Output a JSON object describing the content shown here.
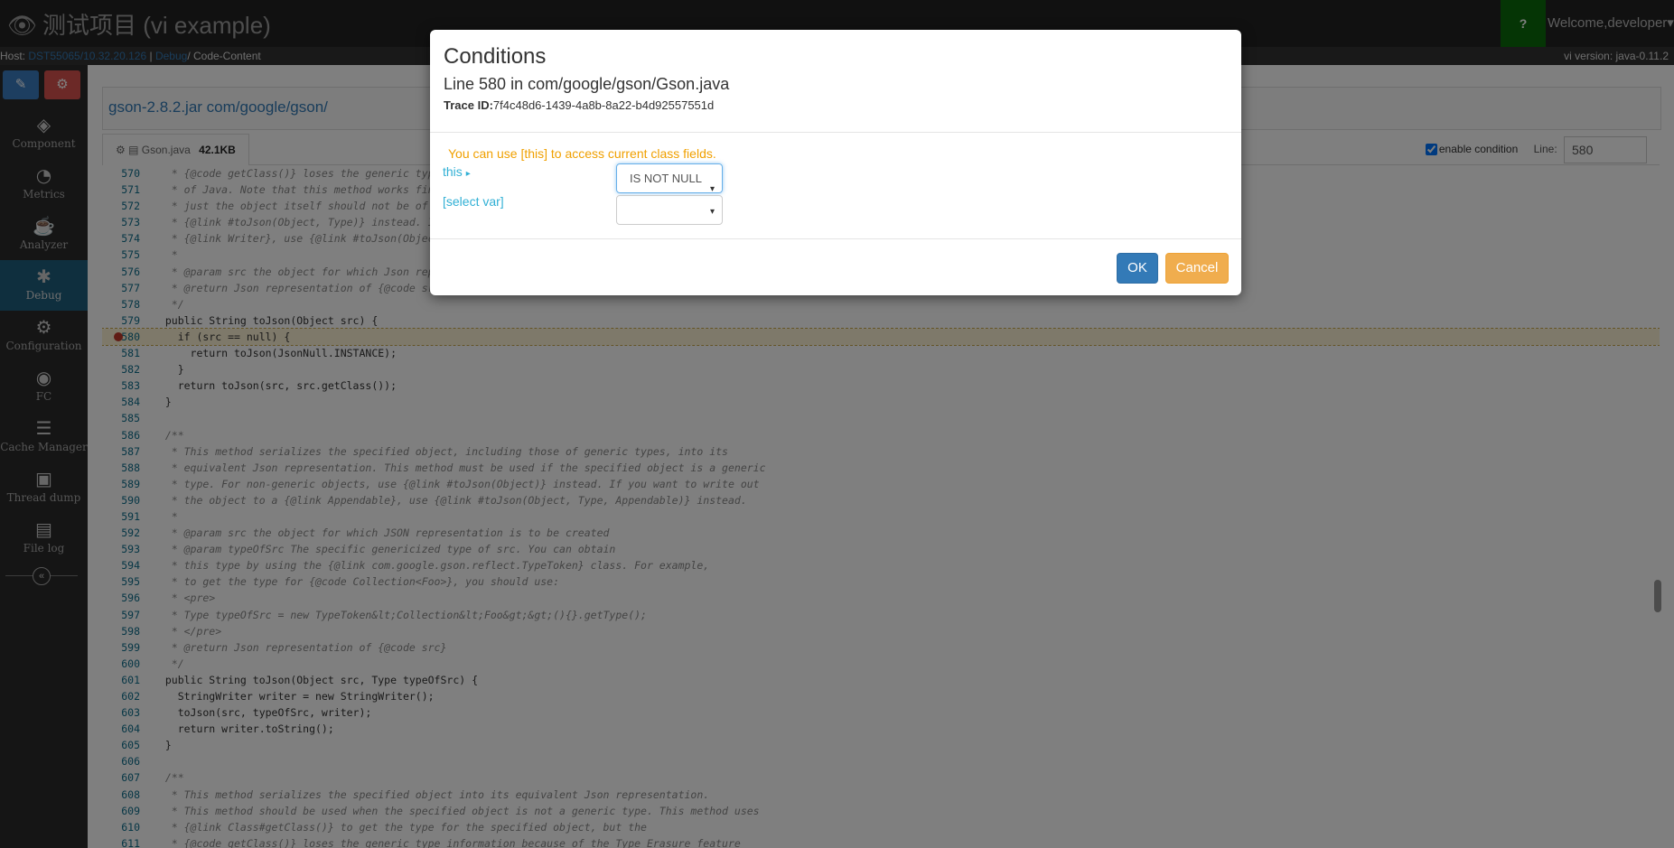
{
  "app": {
    "title": "测试项目 (vi example)",
    "help_label": "?",
    "welcome": "Welcome,developer",
    "eye_glyph": "👁"
  },
  "subbar": {
    "host_label": "Host:",
    "host_value": "DST55065/10.32.20.126",
    "sep": "|",
    "crumb_debug": "Debug",
    "crumb_rest": "/ Code-Content",
    "version": "vi version: java-0.11.2"
  },
  "sidebar": {
    "items": [
      {
        "label": "Component",
        "icon": "cube-icon",
        "glyph": "◈"
      },
      {
        "label": "Metrics",
        "icon": "dashboard-icon",
        "glyph": "◔"
      },
      {
        "label": "Analyzer",
        "icon": "coffee-icon",
        "glyph": "☕"
      },
      {
        "label": "Debug",
        "icon": "bug-icon",
        "glyph": "✱"
      },
      {
        "label": "Configuration",
        "icon": "cogs-icon",
        "glyph": "⚙"
      },
      {
        "label": "FC",
        "icon": "toggle-icon",
        "glyph": "◉"
      },
      {
        "label": "Cache Manager",
        "icon": "database-icon",
        "glyph": "☰"
      },
      {
        "label": "Thread dump",
        "icon": "camera-icon",
        "glyph": "▣"
      },
      {
        "label": "File log",
        "icon": "file-icon",
        "glyph": "▤"
      }
    ],
    "active": "Debug",
    "edit_glyph": "✎",
    "cog_glyph": "⚙",
    "collapse_glyph": "«"
  },
  "main": {
    "path": "gson-2.8.2.jar com/google/gson/",
    "tab_name": "Gson.java",
    "tab_size": "42.1KB",
    "tab_icons": "⚙ ▤",
    "enable_condition": "enable condition",
    "line_label": "Line:",
    "line_value": "580"
  },
  "code": [
    {
      "n": "570",
      "t": "   * {@code getClass()} loses the generic type information because of the Type Erasure feature",
      "c": true
    },
    {
      "n": "571",
      "t": "   * of Java. Note that this method works fine if the any of the object fields are of generic type,",
      "c": true
    },
    {
      "n": "572",
      "t": "   * just the object itself should not be of a generic type. If the object is of generic type, use",
      "c": true
    },
    {
      "n": "573",
      "t": "   * {@link #toJson(Object, Type)} instead. If you want to write out the object to a",
      "c": true
    },
    {
      "n": "574",
      "t": "   * {@link Writer}, use {@link #toJson(Object, Appendable)} instead.",
      "c": true
    },
    {
      "n": "575",
      "t": "   *",
      "c": true
    },
    {
      "n": "576",
      "t": "   * @param src the object for which Json representation is to be created setting for Gson",
      "c": true
    },
    {
      "n": "577",
      "t": "   * @return Json representation of {@code src}.",
      "c": true
    },
    {
      "n": "578",
      "t": "   */",
      "c": true
    },
    {
      "n": "579",
      "t": "  public String toJson(Object src) {",
      "c": false
    },
    {
      "n": "580",
      "t": "    if (src == null) {",
      "c": false,
      "hl": true
    },
    {
      "n": "581",
      "t": "      return toJson(JsonNull.INSTANCE);",
      "c": false
    },
    {
      "n": "582",
      "t": "    }",
      "c": false
    },
    {
      "n": "583",
      "t": "    return toJson(src, src.getClass());",
      "c": false
    },
    {
      "n": "584",
      "t": "  }",
      "c": false
    },
    {
      "n": "585",
      "t": "",
      "c": false
    },
    {
      "n": "586",
      "t": "  /**",
      "c": true
    },
    {
      "n": "587",
      "t": "   * This method serializes the specified object, including those of generic types, into its",
      "c": true
    },
    {
      "n": "588",
      "t": "   * equivalent Json representation. This method must be used if the specified object is a generic",
      "c": true
    },
    {
      "n": "589",
      "t": "   * type. For non-generic objects, use {@link #toJson(Object)} instead. If you want to write out",
      "c": true
    },
    {
      "n": "590",
      "t": "   * the object to a {@link Appendable}, use {@link #toJson(Object, Type, Appendable)} instead.",
      "c": true
    },
    {
      "n": "591",
      "t": "   *",
      "c": true
    },
    {
      "n": "592",
      "t": "   * @param src the object for which JSON representation is to be created",
      "c": true
    },
    {
      "n": "593",
      "t": "   * @param typeOfSrc The specific genericized type of src. You can obtain",
      "c": true
    },
    {
      "n": "594",
      "t": "   * this type by using the {@link com.google.gson.reflect.TypeToken} class. For example,",
      "c": true
    },
    {
      "n": "595",
      "t": "   * to get the type for {@code Collection<Foo>}, you should use:",
      "c": true
    },
    {
      "n": "596",
      "t": "   * <pre>",
      "c": true
    },
    {
      "n": "597",
      "t": "   * Type typeOfSrc = new TypeToken&lt;Collection&lt;Foo&gt;&gt;(){}.getType();",
      "c": true
    },
    {
      "n": "598",
      "t": "   * </pre>",
      "c": true
    },
    {
      "n": "599",
      "t": "   * @return Json representation of {@code src}",
      "c": true
    },
    {
      "n": "600",
      "t": "   */",
      "c": true
    },
    {
      "n": "601",
      "t": "  public String toJson(Object src, Type typeOfSrc) {",
      "c": false
    },
    {
      "n": "602",
      "t": "    StringWriter writer = new StringWriter();",
      "c": false
    },
    {
      "n": "603",
      "t": "    toJson(src, typeOfSrc, writer);",
      "c": false
    },
    {
      "n": "604",
      "t": "    return writer.toString();",
      "c": false
    },
    {
      "n": "605",
      "t": "  }",
      "c": false
    },
    {
      "n": "606",
      "t": "",
      "c": false
    },
    {
      "n": "607",
      "t": "  /**",
      "c": true
    },
    {
      "n": "608",
      "t": "   * This method serializes the specified object into its equivalent Json representation.",
      "c": true
    },
    {
      "n": "609",
      "t": "   * This method should be used when the specified object is not a generic type. This method uses",
      "c": true
    },
    {
      "n": "610",
      "t": "   * {@link Class#getClass()} to get the type for the specified object, but the",
      "c": true
    },
    {
      "n": "611",
      "t": "   * {@code getClass()} loses the generic type information because of the Type Erasure feature",
      "c": true
    }
  ],
  "modal": {
    "title": "Conditions",
    "subtitle": "Line 580 in com/google/gson/Gson.java",
    "trace_label": "Trace ID:",
    "trace_value": "7f4c48d6-1439-4a8b-8a22-b4d92557551d",
    "hint": "You can use [this] to access current class fields.",
    "var_this": "this",
    "var_select": "[select var]",
    "operator": "IS NOT NULL",
    "ok": "OK",
    "cancel": "Cancel",
    "caret": "▾",
    "play": "▸"
  }
}
